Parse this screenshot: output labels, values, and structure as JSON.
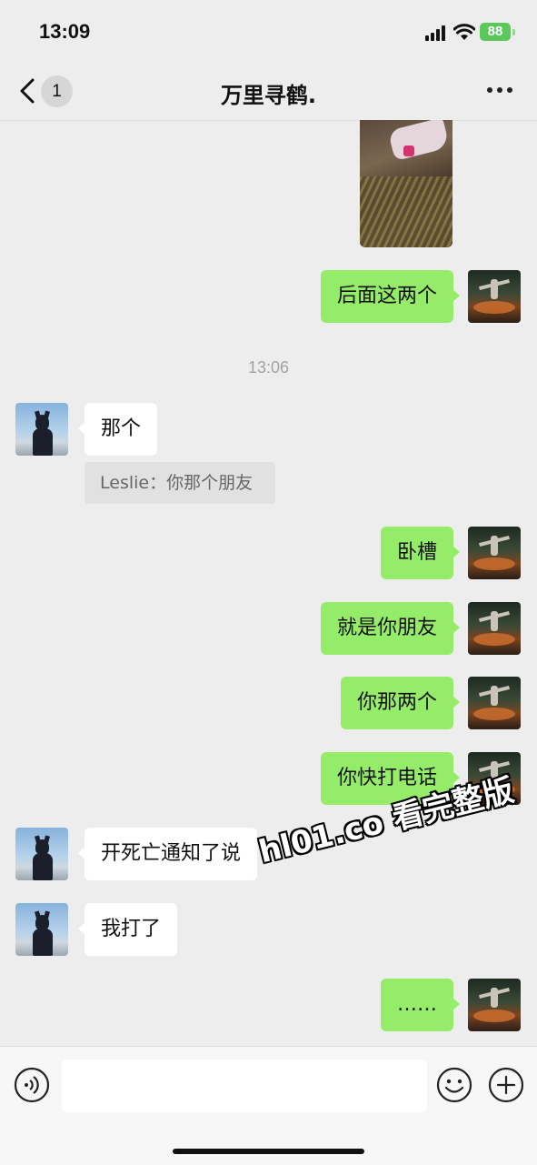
{
  "status_bar": {
    "time": "13:09",
    "battery": "88"
  },
  "header": {
    "back_badge": "1",
    "title": "万里寻鹤."
  },
  "chat": {
    "messages": [
      {
        "text": "后面这两个",
        "side": "right"
      },
      {
        "timestamp": "13:06"
      },
      {
        "text": "那个",
        "side": "left",
        "quote": "Leslie：你那个朋友"
      },
      {
        "text": "卧槽",
        "side": "right"
      },
      {
        "text": "就是你朋友",
        "side": "right"
      },
      {
        "text": "你那两个",
        "side": "right"
      },
      {
        "text": "你快打电话",
        "side": "right"
      },
      {
        "text": "开死亡通知了说",
        "side": "left"
      },
      {
        "text": "我打了",
        "side": "left"
      },
      {
        "text": "……",
        "side": "right"
      }
    ],
    "watermark": "hl01.co 看完整版"
  },
  "colors": {
    "sent_bubble": "#95ec69",
    "received_bubble": "#ffffff",
    "background": "#ededed"
  },
  "icons": [
    "back-icon",
    "more-icon",
    "voice-icon",
    "emoji-icon",
    "plus-icon"
  ]
}
